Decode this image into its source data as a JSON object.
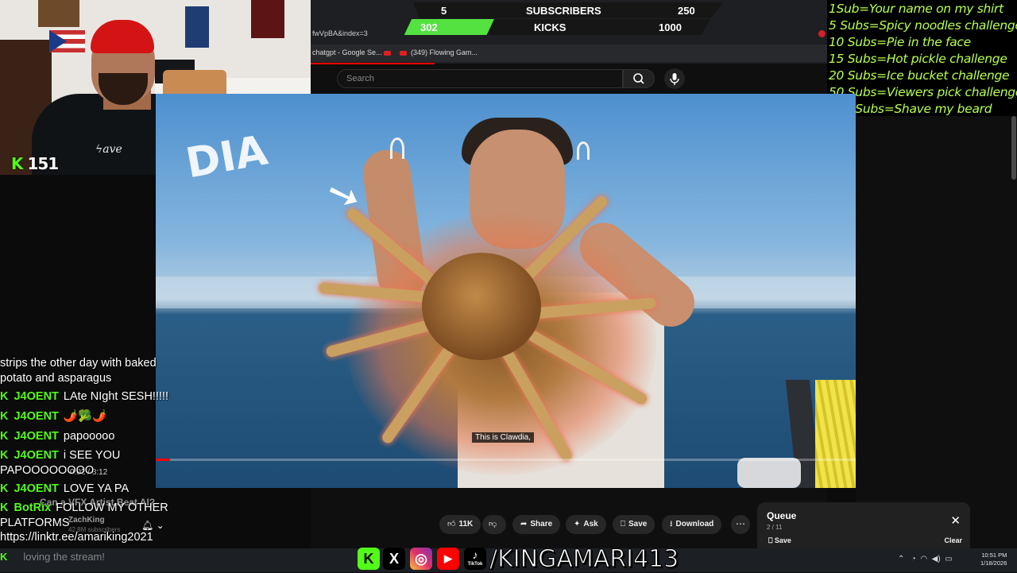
{
  "goals": {
    "subscribers_label": "SUBSCRIBERS",
    "subscribers_current": "5",
    "subscribers_target": "250",
    "kicks_label": "KICKS",
    "kicks_current": "302",
    "kicks_target": "1000",
    "kicks_progress": 0.302
  },
  "goal_list": [
    "1Sub=Your name on my shirt",
    "5 Subs=Spicy noodles challenge",
    "10 Subs=Pie in the face",
    "15 Subs=Hot pickle challenge",
    "20 Subs=Ice bucket challenge",
    "50 Subs=Viewers pick challenge",
    "100 Subs=Shave my beard"
  ],
  "browser": {
    "url_fragment": "fwVpBA&index=3",
    "tabs": [
      "chatgpt - Google Se...",
      "(349) Flowing Gam..."
    ],
    "search_placeholder": "Search"
  },
  "webcam": {
    "follower_count": "151",
    "follower_icon": "K"
  },
  "video": {
    "overlay_text": "DIA",
    "caption": "This is Clawdia,",
    "progress": 0.02
  },
  "actions": {
    "like_count": "11K",
    "share": "Share",
    "ask": "Ask",
    "save": "Save",
    "download": "Download"
  },
  "queue": {
    "title": "Queue",
    "count": "2 / 11",
    "save": "Save",
    "clear": "Clear"
  },
  "chat": {
    "lines": [
      {
        "user": "",
        "msg": "strips the other day with baked",
        "icon": false
      },
      {
        "user": "",
        "msg": "potato and asparagus",
        "icon": false
      },
      {
        "user": "J4OENT",
        "msg": "LAte NIght SESH!!!!!",
        "icon": true
      },
      {
        "user": "J4OENT",
        "msg": "🌶️🥦🌶️",
        "icon": true
      },
      {
        "user": "J4OENT",
        "msg": "papooooo",
        "icon": true
      },
      {
        "user": "J4OENT",
        "msg": "i SEE YOU",
        "icon": true
      },
      {
        "user": "",
        "msg": "PAPOOOOOOOO",
        "icon": false
      },
      {
        "user": "J4OENT",
        "msg": "LOVE YA PA",
        "icon": true
      },
      {
        "user": "BotRix",
        "msg": "FOLLOW MY OTHER",
        "icon": true
      },
      {
        "user": "",
        "msg": "PLATFORMS",
        "icon": false
      },
      {
        "user": "",
        "msg": "https://linktr.ee/amariking2021",
        "icon": false
      }
    ],
    "last_line_user": "",
    "last_line_msg": "loving the stream!"
  },
  "under_video": {
    "title": "Can a VFX Artist Beat AI?",
    "channel": "ZachKing",
    "channel_subs": "42.8M subscribers",
    "time": "0:02 / 8:12"
  },
  "socials": {
    "handle": "/KINGAMARI413",
    "icons": [
      "kick-icon",
      "x-icon",
      "instagram-icon",
      "youtube-icon",
      "tiktok-icon"
    ],
    "tiktok_label": "TikTok"
  },
  "taskbar": {
    "time": "10:51 PM",
    "date": "1/18/2026"
  },
  "colors": {
    "kick_green": "#53fc18",
    "goal_text": "#b7ff4c",
    "youtube_red": "#ff0000"
  }
}
